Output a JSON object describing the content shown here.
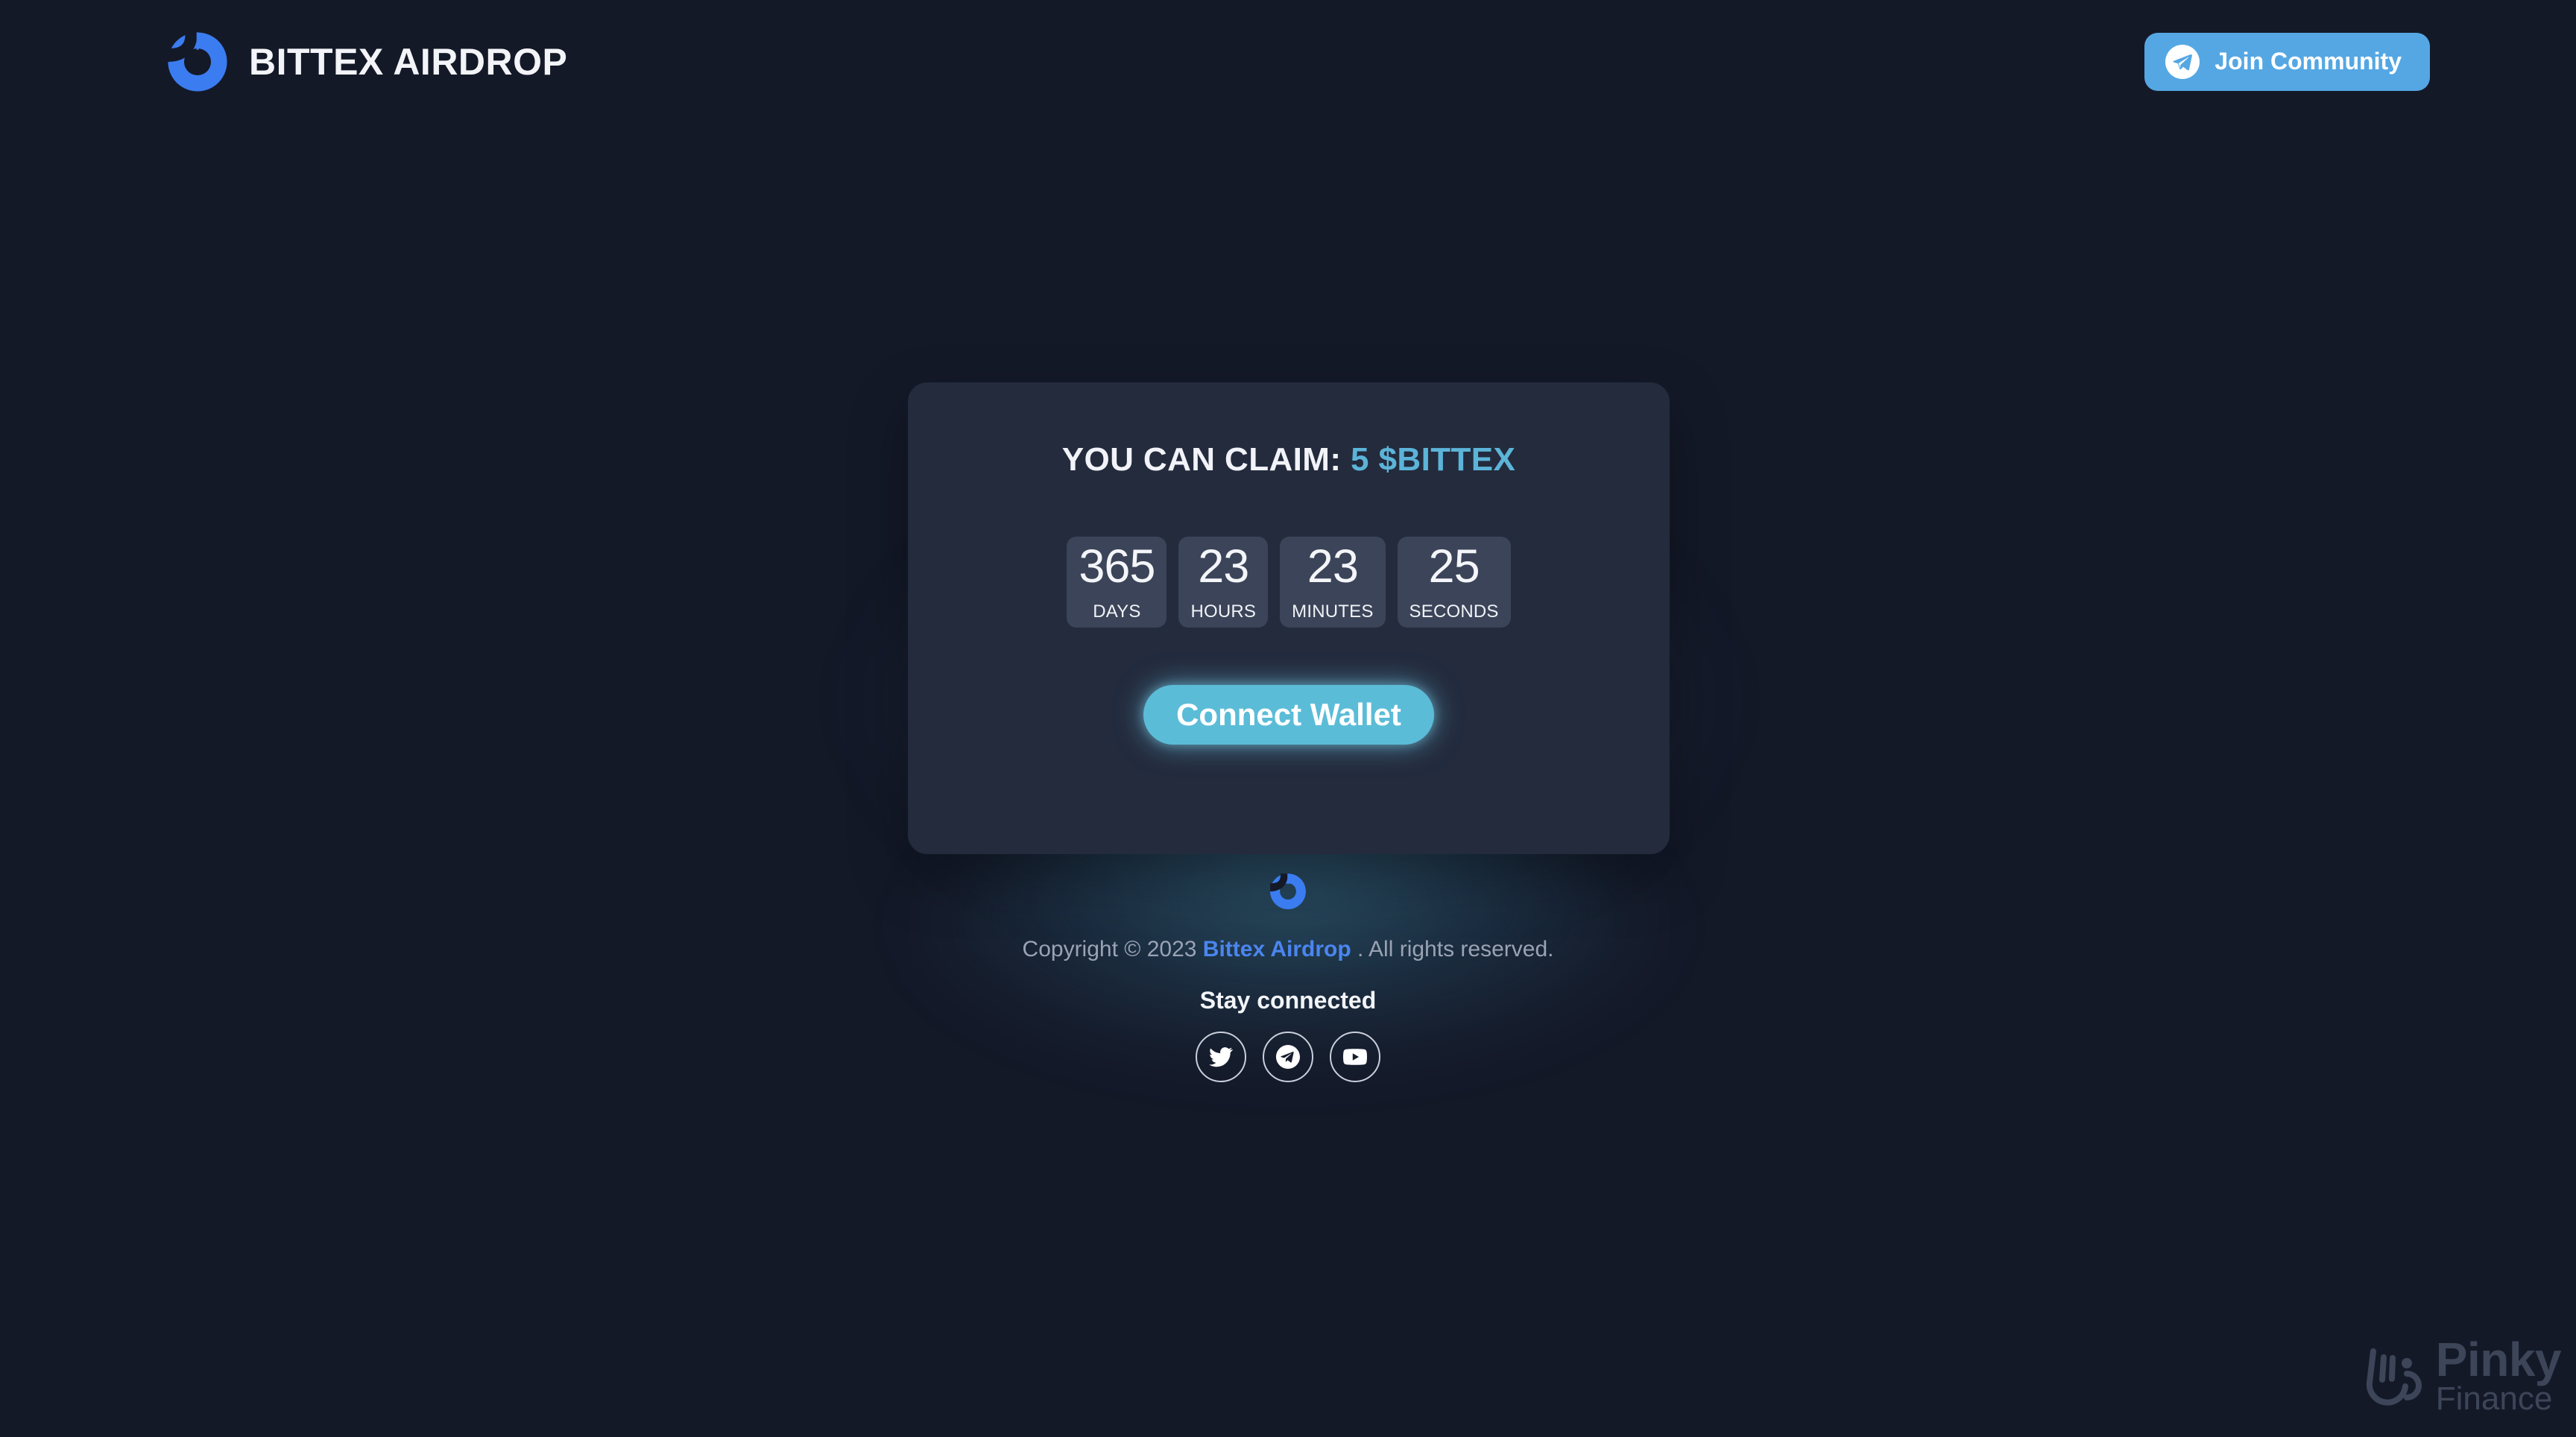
{
  "header": {
    "logo_icon": "bittex-ring-logo",
    "brand_title": "BITTEX AIRDROP",
    "join_button": {
      "label": "Join Community",
      "icon": "telegram-icon"
    }
  },
  "card": {
    "claim_label": "YOU CAN CLAIM:",
    "claim_amount": "5 $BITTEX",
    "countdown": [
      {
        "value": "365",
        "label": "DAYS"
      },
      {
        "value": "23",
        "label": "HOURS"
      },
      {
        "value": "23",
        "label": "MINUTES"
      },
      {
        "value": "25",
        "label": "SECONDS"
      }
    ],
    "connect_button": "Connect Wallet"
  },
  "footer": {
    "logo_icon": "bittex-ring-logo",
    "copyright_prefix": "Copyright © 2023",
    "copyright_link": "Bittex Airdrop",
    "copyright_suffix": ". All rights reserved.",
    "stay_connected": "Stay connected",
    "socials": [
      {
        "name": "twitter",
        "icon": "twitter-icon"
      },
      {
        "name": "telegram",
        "icon": "telegram-icon"
      },
      {
        "name": "youtube",
        "icon": "youtube-icon"
      }
    ]
  },
  "watermark": {
    "icon": "pinky-hand-icon",
    "line1": "Pinky",
    "line2": "Finance"
  },
  "colors": {
    "background": "#141928",
    "card": "#232b3d",
    "timer_box": "#3b4458",
    "brand_blue": "#3b7cf0",
    "accent_cyan": "#5bbcd8",
    "join_blue": "#55a7e3",
    "link_blue": "#4a86f0",
    "muted_text": "#9aa3b4",
    "watermark": "#3d4558"
  }
}
